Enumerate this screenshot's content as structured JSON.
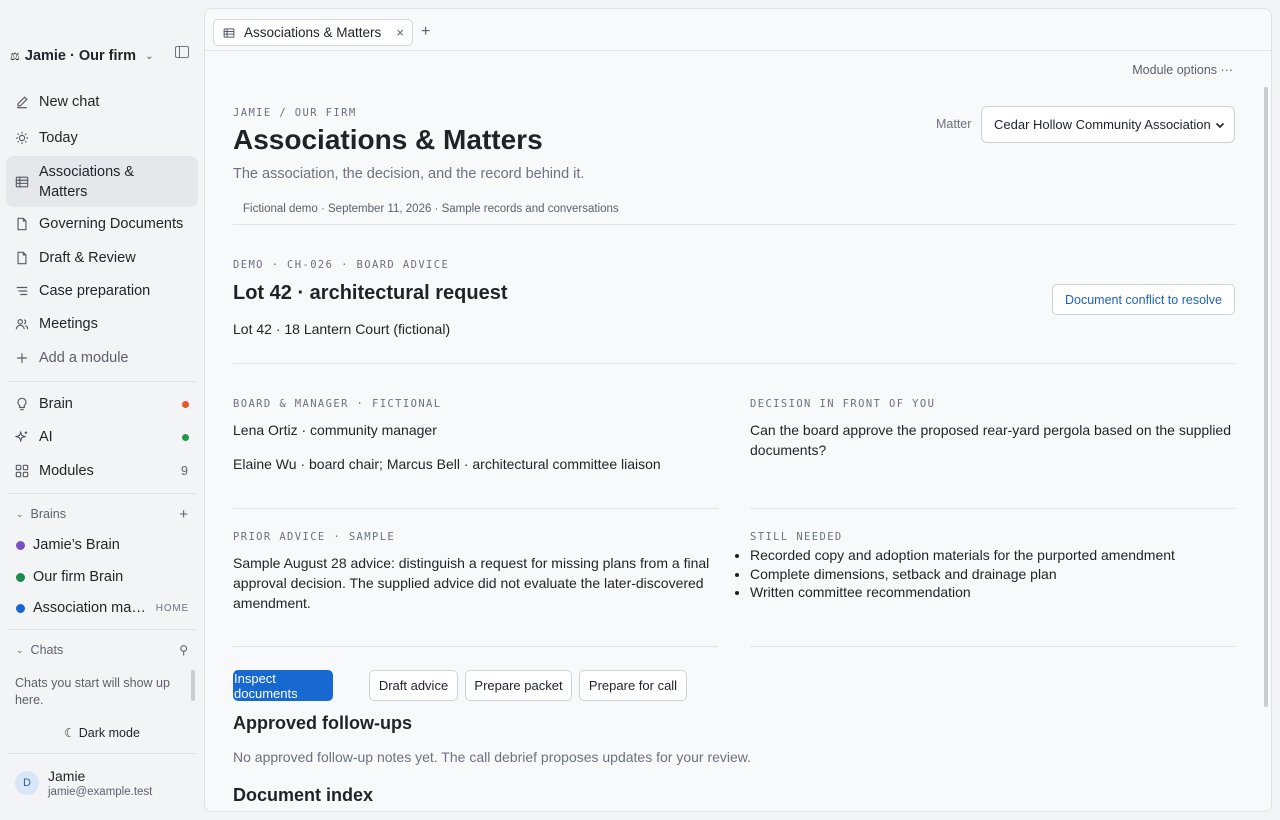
{
  "sidebar": {
    "workspace": "Jamie · Our firm",
    "nav": [
      {
        "label": "New chat",
        "icon": "pencil-icon"
      },
      {
        "label": "Today",
        "icon": "sun-icon"
      },
      {
        "label": "Associations & Matters",
        "icon": "table-icon",
        "active": true
      },
      {
        "label": "Governing Documents",
        "icon": "document-icon"
      },
      {
        "label": "Draft & Review",
        "icon": "document-icon"
      },
      {
        "label": "Case preparation",
        "icon": "list-icon"
      },
      {
        "label": "Meetings",
        "icon": "people-icon"
      },
      {
        "label": "Add a module",
        "icon": "plus-icon"
      }
    ],
    "system": [
      {
        "label": "Brain",
        "icon": "lightbulb-icon",
        "status_color": "#e4572e"
      },
      {
        "label": "AI",
        "icon": "sparkle-icon",
        "status_color": "#1f9a4f"
      },
      {
        "label": "Modules",
        "icon": "grid-icon",
        "count": "9"
      }
    ],
    "brains_header": "Brains",
    "brains": [
      {
        "label": "Jamie’s Brain",
        "color": "#7b4fc9"
      },
      {
        "label": "Our firm Brain",
        "color": "#1f8a4c"
      },
      {
        "label": "Association management",
        "color": "#1769d1",
        "tag": "HOME"
      }
    ],
    "chats_header": "Chats",
    "chats_empty": "Chats you start will show up here.",
    "dark_mode": "Dark mode",
    "user": {
      "initial": "D",
      "name": "Jamie",
      "email": "jamie@example.test"
    }
  },
  "tabs": [
    {
      "label": "Associations & Matters",
      "close": "×"
    }
  ],
  "tab_add": "+",
  "module_options": "Module options ···",
  "header": {
    "breadcrumb": "JAMIE / OUR FIRM",
    "title": "Associations & Matters",
    "subtitle": "The association, the decision, and the record behind it.",
    "meta": "Fictional demo · September 11, 2026 · Sample records and conversations",
    "matter_label": "Matter",
    "matter_value": "Cedar Hollow Community Association"
  },
  "matter": {
    "eyebrow": "DEMO · CH-026 · BOARD ADVICE",
    "title": "Lot 42 · architectural request",
    "address": "Lot 42 · 18 Lantern Court (fictional)",
    "conflict_button": "Document conflict to resolve",
    "board_eyebrow": "BOARD & MANAGER · FICTIONAL",
    "board_line1": "Lena Ortiz · community manager",
    "board_line2": "Elaine Wu · board chair; Marcus Bell · architectural committee liaison",
    "decision_eyebrow": "DECISION IN FRONT OF YOU",
    "decision_text": "Can the board approve the proposed rear-yard pergola based on the supplied documents?",
    "prior_eyebrow": "PRIOR ADVICE · SAMPLE",
    "prior_text": "Sample August 28 advice: distinguish a request for missing plans from a final approval decision. The supplied advice did not evaluate the later-discovered amendment.",
    "needed_eyebrow": "STILL NEEDED",
    "needed_items": [
      "Recorded copy and adoption materials for the purported amendment",
      "Complete dimensions, setback and drainage plan",
      "Written committee recommendation"
    ]
  },
  "actions": [
    "Inspect documents",
    "Draft advice",
    "Prepare packet",
    "Prepare for call"
  ],
  "followups": {
    "title": "Approved follow-ups",
    "empty": "No approved follow-up notes yet. The call debrief proposes updates for your review."
  },
  "document_index": {
    "title": "Document index"
  }
}
